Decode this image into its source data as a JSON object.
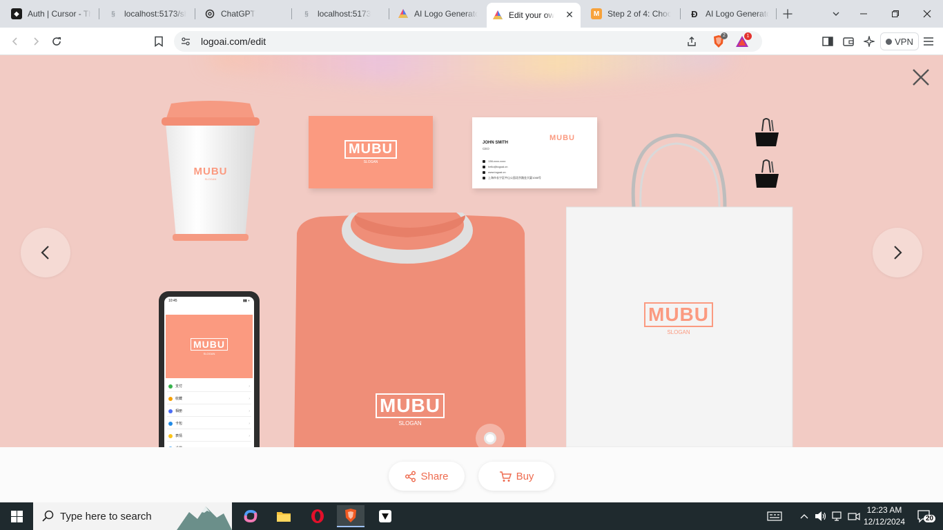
{
  "browser": {
    "tabs": [
      {
        "title": "Auth | Cursor - Th",
        "favicon": "cursor-icon",
        "active": false
      },
      {
        "title": "localhost:5173/sh",
        "favicon": "s-icon",
        "active": false
      },
      {
        "title": "ChatGPT",
        "favicon": "openai-icon",
        "active": false
      },
      {
        "title": "localhost:5173",
        "favicon": "s-icon",
        "active": false
      },
      {
        "title": "AI Logo Generato",
        "favicon": "logoai-icon",
        "active": false
      },
      {
        "title": "Edit your ow",
        "favicon": "logoai-icon",
        "active": true
      },
      {
        "title": "Step 2 of 4: Choo",
        "favicon": "m-icon",
        "active": false
      },
      {
        "title": "AI Logo Generato",
        "favicon": "d-icon",
        "active": false
      }
    ],
    "url": "logoai.com/edit",
    "vpn_label": "VPN",
    "brave_badge": "2",
    "rewards_badge": "1"
  },
  "mockup": {
    "brand_letters": "MUBU",
    "slogan": "SLOGAN",
    "card_name": "JOHN SMITH",
    "card_role": "CEO",
    "card_phone": "138-xxxx-xxxx",
    "card_email": "hello@logoai.cn",
    "card_web": "www.logoai.cn",
    "card_address": "上海市长宁区中山公园北京路金大厦1088号",
    "phone_time": "10:45",
    "phone_menu": [
      "支付",
      "收藏",
      "相册",
      "卡包",
      "表情",
      "设置"
    ],
    "accent_color": "#fb9a80",
    "background_color": "#f2cbc4"
  },
  "actions": {
    "share_label": "Share",
    "buy_label": "Buy"
  },
  "taskbar": {
    "search_placeholder": "Type here to search",
    "time": "12:23 AM",
    "date": "12/12/2024",
    "notification_count": "20"
  }
}
